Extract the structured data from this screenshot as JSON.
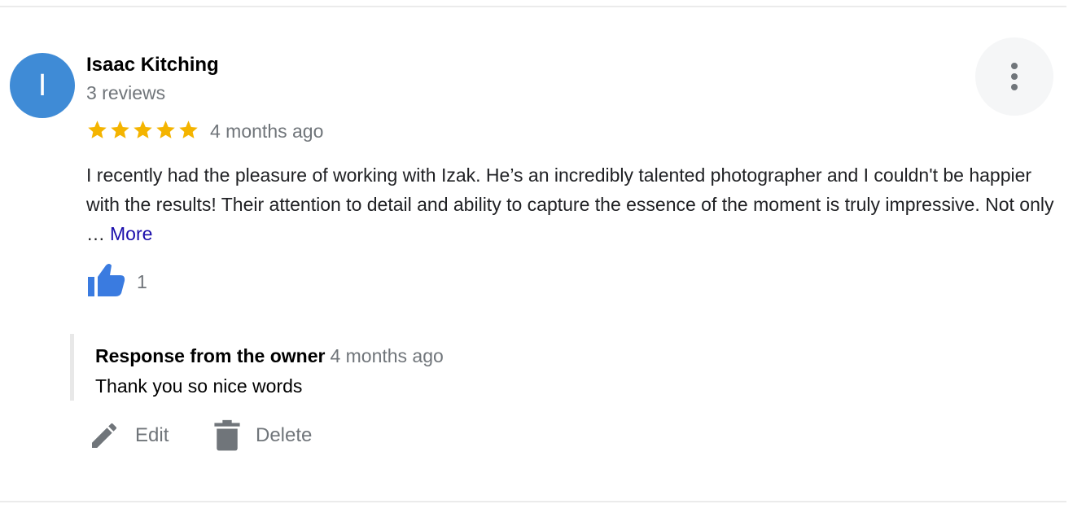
{
  "reviewer": {
    "initial": "I",
    "name": "Isaac Kitching",
    "review_count": "3 reviews",
    "avatar_color": "#3f8bd6"
  },
  "review": {
    "rating": 5,
    "max_rating": 5,
    "star_color": "#f4b400",
    "date": "4 months ago",
    "text": "I recently had the pleasure of working with Izak. He’s an incredibly talented photographer and I couldn't be happier with the results! Their attention to detail and ability to capture the essence of the moment is truly impressive. Not only …",
    "more_label": "More",
    "like_count": "1",
    "like_icon": "thumbs-up-icon",
    "menu_icon": "more-vert-icon"
  },
  "owner_response": {
    "title": "Response from the owner",
    "date": "4 months ago",
    "text": "Thank you so nice words"
  },
  "actions": {
    "edit_label": "Edit",
    "edit_icon": "pencil-icon",
    "delete_label": "Delete",
    "delete_icon": "trash-icon"
  },
  "colors": {
    "like_blue": "#3a7be0",
    "link_blue": "#1a0dab",
    "muted_gray": "#70757a"
  }
}
